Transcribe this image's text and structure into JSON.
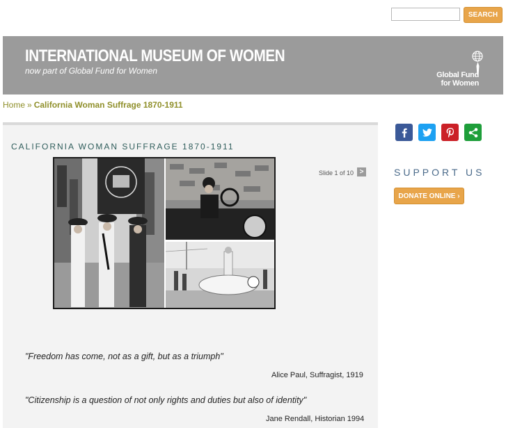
{
  "search": {
    "placeholder": "",
    "value": "",
    "button_label": "SEARCH"
  },
  "header": {
    "title": "INTERNATIONAL MUSEUM OF WOMEN",
    "subtitle": "now part of Global Fund for Women",
    "logo_text_line1": "Global Fund",
    "logo_text_line2": "for Women"
  },
  "breadcrumb": {
    "home": "Home",
    "separator": "»",
    "current": "California Woman Suffrage 1870-1911"
  },
  "main": {
    "title": "CALIFORNIA WOMAN SUFFRAGE 1870-1911",
    "slideshow": {
      "counter": "Slide 1 of 10",
      "next_label": ">"
    },
    "quotes": [
      {
        "text": "\"Freedom has come, not as a gift, but as a triumph\"",
        "attribution": "Alice Paul, Suffragist, 1919"
      },
      {
        "text": "\"Citizenship is a question of not only rights and duties but also of identity\"",
        "attribution": "Jane Rendall, Historian 1994"
      }
    ]
  },
  "sidebar": {
    "share": [
      {
        "name": "facebook",
        "icon": "facebook-icon",
        "glyph": "f",
        "color": "#3b5998"
      },
      {
        "name": "twitter",
        "icon": "twitter-icon",
        "glyph": "",
        "color": "#1da1f2"
      },
      {
        "name": "pinterest",
        "icon": "pinterest-icon",
        "glyph": "p",
        "color": "#cb2027"
      },
      {
        "name": "share",
        "icon": "share-icon",
        "glyph": "",
        "color": "#1e9e3a"
      }
    ],
    "support_title": "SUPPORT US",
    "donate_label": "DONATE ONLINE ›"
  },
  "colors": {
    "accent": "#e8a54a",
    "banner": "#9b9b9b",
    "breadcrumb": "#8f8f2a",
    "title": "#2f5d5b"
  }
}
